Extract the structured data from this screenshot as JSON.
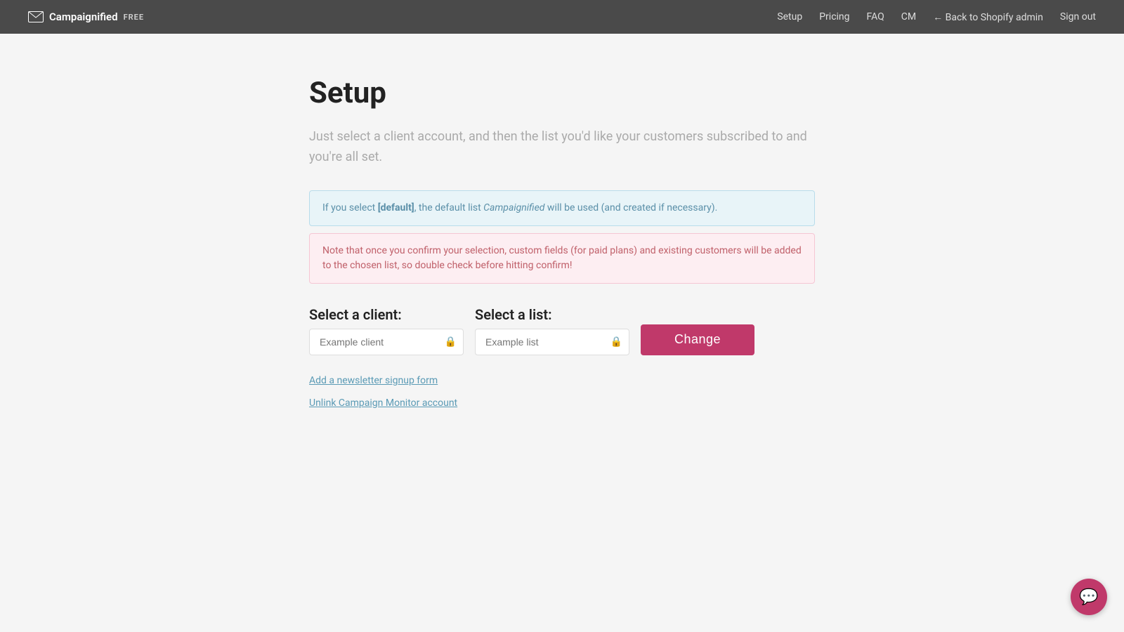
{
  "header": {
    "brand": {
      "name": "Campaignified",
      "badge": "FREE",
      "logo_icon": "envelope"
    },
    "nav": [
      {
        "label": "Setup",
        "href": "#"
      },
      {
        "label": "Pricing",
        "href": "#"
      },
      {
        "label": "FAQ",
        "href": "#"
      },
      {
        "label": "CM",
        "href": "#"
      },
      {
        "label": "← Back to Shopify admin",
        "href": "#"
      },
      {
        "label": "Sign out",
        "href": "#"
      }
    ]
  },
  "main": {
    "title": "Setup",
    "description": "Just select a client account, and then the list you'd like your customers subscribed to and you're all set.",
    "info_blue": {
      "prefix": "If you select ",
      "bold": "[default]",
      "suffix": ", the default list ",
      "italic": "Campaignified",
      "end": " will be used (and created if necessary)."
    },
    "info_pink": "Note that once you confirm your selection, custom fields (for paid plans) and existing customers will be added to the chosen list, so double check before hitting confirm!",
    "client_label": "Select a client:",
    "client_placeholder": "Example client",
    "list_label": "Select a list:",
    "list_placeholder": "Example list",
    "change_button": "Change",
    "links": [
      {
        "label": "Add a newsletter signup form"
      },
      {
        "label": "Unlink Campaign Monitor account"
      }
    ]
  },
  "colors": {
    "accent": "#c0396a",
    "link": "#5a9ab5"
  }
}
